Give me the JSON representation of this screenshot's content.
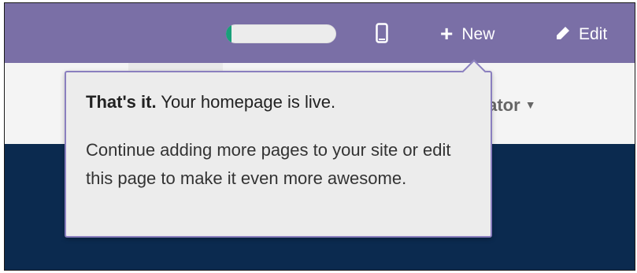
{
  "topbar": {
    "progress_fraction": 0.05,
    "mobile_icon": "mobile-phone-icon",
    "new_button": {
      "icon": "plus-icon",
      "label": "New"
    },
    "edit_button": {
      "icon": "pencil-icon",
      "label": "Edit"
    }
  },
  "navbar": {
    "account_label": "strator"
  },
  "popover": {
    "title_bold": "That's it.",
    "title_rest": " Your homepage is live.",
    "body": "Continue adding more pages to your site or edit this page to make it even more awesome."
  },
  "colors": {
    "topbar": "#7a6fa6",
    "banner": "#0b2a4f",
    "popover_bg": "#ececec",
    "progress_fill": "#1a9f7a"
  }
}
